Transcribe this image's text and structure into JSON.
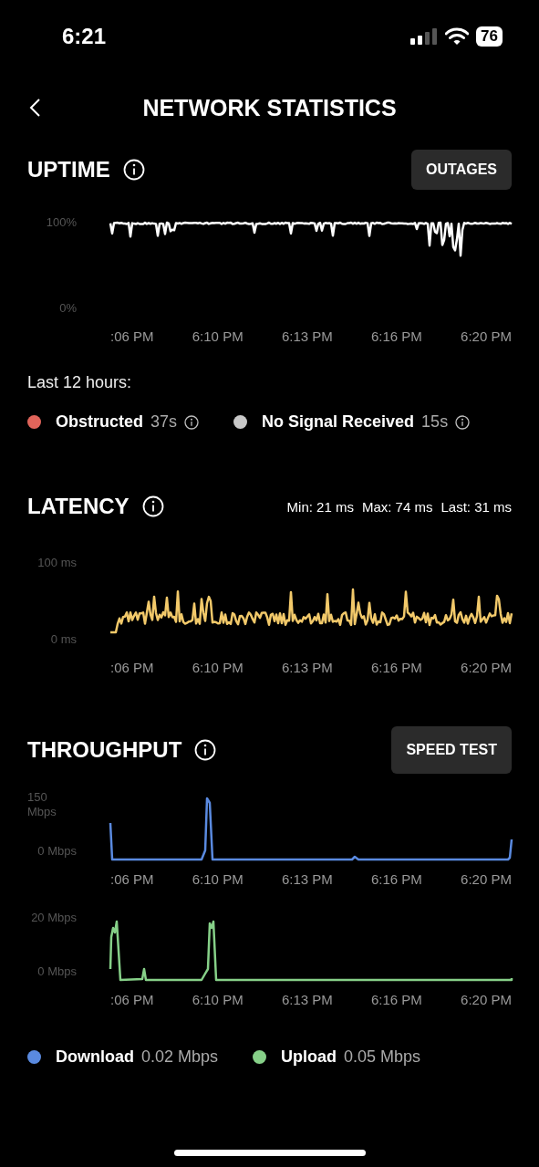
{
  "status_bar": {
    "time": "6:21",
    "battery": "76"
  },
  "header": {
    "title": "NETWORK STATISTICS"
  },
  "uptime": {
    "title": "UPTIME",
    "button": "OUTAGES",
    "chart": {
      "kind": "uptime",
      "y_labels": [
        "100%",
        "0%"
      ],
      "x_labels": [
        ":06 PM",
        "6:10 PM",
        "6:13 PM",
        "6:16 PM",
        "6:20 PM"
      ]
    },
    "period": "Last 12 hours:",
    "legend": [
      {
        "label": "Obstructed",
        "value": "37s",
        "color": "#e0645a"
      },
      {
        "label": "No Signal Received",
        "value": "15s",
        "color": "#c8c8c8"
      }
    ]
  },
  "latency": {
    "title": "LATENCY",
    "stats": [
      "Min: 21 ms",
      "Max: 74 ms",
      "Last: 31 ms"
    ],
    "chart": {
      "kind": "latency",
      "y_labels": [
        "100 ms",
        "0 ms"
      ],
      "x_labels": [
        ":06 PM",
        "6:10 PM",
        "6:13 PM",
        "6:16 PM",
        "6:20 PM"
      ]
    }
  },
  "throughput": {
    "title": "THROUGHPUT",
    "button": "SPEED TEST",
    "charts": [
      {
        "kind": "download",
        "y_labels": [
          "150 Mbps",
          "0 Mbps"
        ],
        "x_labels": [
          ":06 PM",
          "6:10 PM",
          "6:13 PM",
          "6:16 PM",
          "6:20 PM"
        ]
      },
      {
        "kind": "upload",
        "y_labels": [
          "20 Mbps",
          "0 Mbps"
        ],
        "x_labels": [
          ":06 PM",
          "6:10 PM",
          "6:13 PM",
          "6:16 PM",
          "6:20 PM"
        ]
      }
    ],
    "legend": [
      {
        "label": "Download",
        "value": "0.02 Mbps",
        "color": "#5a8ae0"
      },
      {
        "label": "Upload",
        "value": "0.05 Mbps",
        "color": "#86d088"
      }
    ]
  }
}
